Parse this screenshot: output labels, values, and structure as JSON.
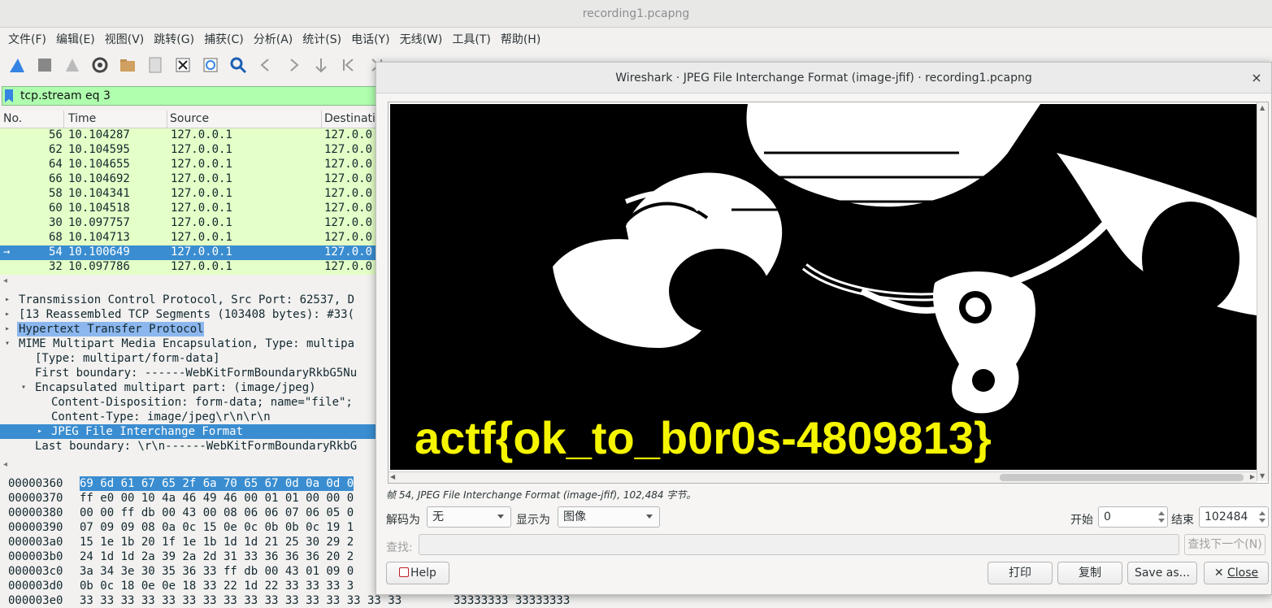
{
  "window": {
    "title": "recording1.pcapng"
  },
  "menu": [
    "文件(F)",
    "编辑(E)",
    "视图(V)",
    "跳转(G)",
    "捕获(C)",
    "分析(A)",
    "统计(S)",
    "电话(Y)",
    "无线(W)",
    "工具(T)",
    "帮助(H)"
  ],
  "filter": {
    "value": "tcp.stream eq 3"
  },
  "packet_list": {
    "columns": [
      "No.",
      "Time",
      "Source",
      "Destinatic"
    ],
    "rows": [
      {
        "no": "56",
        "time": "10.104287",
        "src": "127.0.0.1",
        "dst": "127.0.0"
      },
      {
        "no": "62",
        "time": "10.104595",
        "src": "127.0.0.1",
        "dst": "127.0.0"
      },
      {
        "no": "64",
        "time": "10.104655",
        "src": "127.0.0.1",
        "dst": "127.0.0"
      },
      {
        "no": "66",
        "time": "10.104692",
        "src": "127.0.0.1",
        "dst": "127.0.0"
      },
      {
        "no": "58",
        "time": "10.104341",
        "src": "127.0.0.1",
        "dst": "127.0.0"
      },
      {
        "no": "60",
        "time": "10.104518",
        "src": "127.0.0.1",
        "dst": "127.0.0"
      },
      {
        "no": "30",
        "time": "10.097757",
        "src": "127.0.0.1",
        "dst": "127.0.0"
      },
      {
        "no": "68",
        "time": "10.104713",
        "src": "127.0.0.1",
        "dst": "127.0.0"
      },
      {
        "no": "54",
        "time": "10.100649",
        "src": "127.0.0.1",
        "dst": "127.0.0"
      },
      {
        "no": "32",
        "time": "10.097786",
        "src": "127.0.0.1",
        "dst": "127.0.0"
      }
    ]
  },
  "tree": [
    "Transmission Control Protocol, Src Port: 62537, D",
    "[13 Reassembled TCP Segments (103408 bytes): #33(",
    "Hypertext Transfer Protocol",
    "MIME Multipart Media Encapsulation, Type: multipa",
    "[Type: multipart/form-data]",
    "First boundary: ------WebKitFormBoundaryRkbG5Nu",
    "Encapsulated multipart part:  (image/jpeg)",
    "Content-Disposition: form-data; name=\"file\";",
    "Content-Type: image/jpeg\\r\\n\\r\\n",
    "JPEG File Interchange Format",
    "Last boundary: \\r\\n------WebKitFormBoundaryRkbG"
  ],
  "hex": [
    {
      "offset": "00000360",
      "bytes": "69 6d 61 67 65 2f 6a 70  65 67 0d 0a 0d 0",
      "ascii": ""
    },
    {
      "offset": "00000370",
      "bytes": "ff e0 00 10 4a 46 49 46  00 01 01 00 00 0",
      "ascii": ""
    },
    {
      "offset": "00000380",
      "bytes": "00 00 ff db 00 43 00 08  06 06 07 06 05 0",
      "ascii": ""
    },
    {
      "offset": "00000390",
      "bytes": "07 09 09 08 0a 0c 15 0e  0c 0b 0b 0c 19 1",
      "ascii": ""
    },
    {
      "offset": "000003a0",
      "bytes": "15 1e 1b 20 1f 1e 1b 1d  1d 21 25 30 29 2",
      "ascii": ""
    },
    {
      "offset": "000003b0",
      "bytes": "24 1d 1d 2a 39 2a 2d 31  33 36 36 36 20 2",
      "ascii": ""
    },
    {
      "offset": "000003c0",
      "bytes": "3a 34 3e 30 35 36 33 ff  db 00 43 01 09 0",
      "ascii": ""
    },
    {
      "offset": "000003d0",
      "bytes": "0b 0c 18 0e 0e 18 33 22  1d 22 33 33 33 3",
      "ascii": ""
    },
    {
      "offset": "000003e0",
      "bytes": "33 33 33 33 33 33 33 33  33 33 33 33 33 33 33 33",
      "ascii": "33333333 33333333"
    }
  ],
  "dialog": {
    "title": "Wireshark · JPEG File Interchange Format (image-jfif) · recording1.pcapng",
    "close_glyph": "×",
    "image_text": "actf{ok_to_b0r0s-4809813}",
    "frame_info": "帧 54, JPEG File Interchange Format (image-jfif), 102,484 字节。",
    "decode_label": "解码为",
    "decode_value": "无",
    "show_label": "显示为",
    "show_value": "图像",
    "start_label": "开始",
    "start_value": "0",
    "end_label": "结束",
    "end_value": "102484",
    "find_label": "查找:",
    "find_next": "查找下一个(N)",
    "help": "Help",
    "print": "打印",
    "copy": "复制",
    "save_as": "Save as...",
    "close": "Close"
  }
}
